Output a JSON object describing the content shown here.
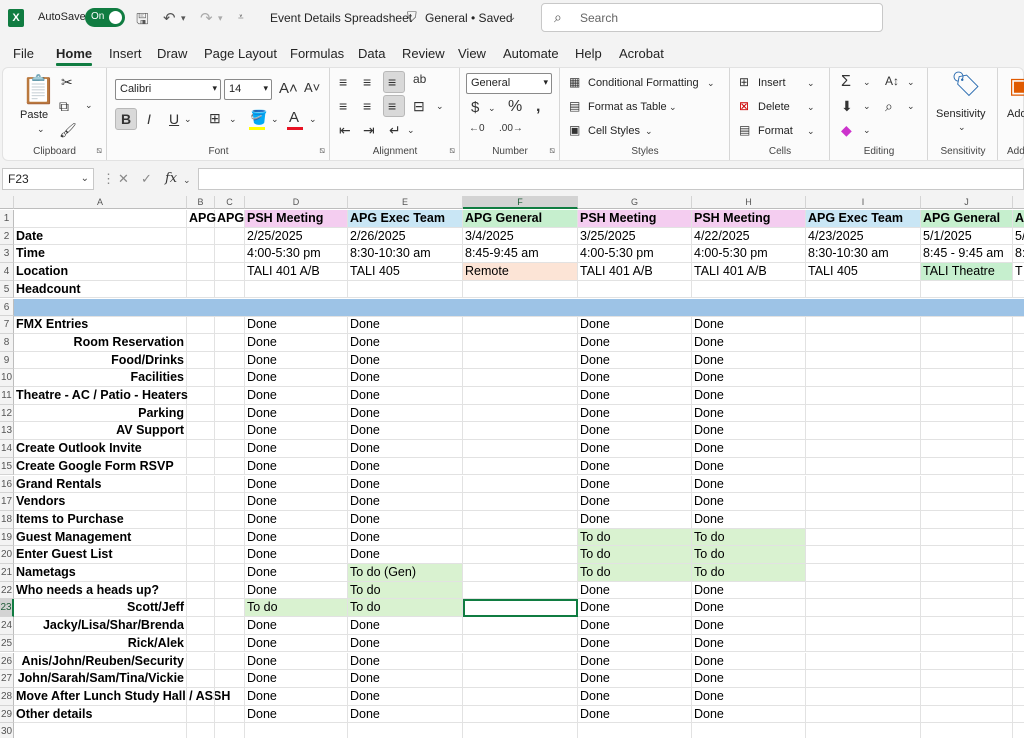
{
  "titlebar": {
    "app_icon": "X",
    "autosave_label": "AutoSave",
    "autosave_state": "On",
    "doc_title": "Event Details Spreadsheet",
    "doc_status": "General • Saved",
    "search_placeholder": "Search"
  },
  "menu_tabs": [
    "File",
    "Home",
    "Insert",
    "Draw",
    "Page Layout",
    "Formulas",
    "Data",
    "Review",
    "View",
    "Automate",
    "Help",
    "Acrobat"
  ],
  "ribbon": {
    "clipboard": {
      "label": "Clipboard",
      "paste": "Paste"
    },
    "font": {
      "label": "Font",
      "font_name": "Calibri",
      "font_size": "14"
    },
    "alignment": {
      "label": "Alignment"
    },
    "number": {
      "label": "Number",
      "format": "General"
    },
    "styles": {
      "label": "Styles",
      "conditional": "Conditional Formatting",
      "table": "Format as Table",
      "cell_styles": "Cell Styles"
    },
    "cells": {
      "label": "Cells",
      "insert": "Insert",
      "delete": "Delete",
      "format": "Format"
    },
    "editing": {
      "label": "Editing"
    },
    "sensitivity": {
      "label": "Sensitivity",
      "button": "Sensitivity"
    },
    "addins": {
      "label": "Add",
      "button": "Add"
    }
  },
  "formula_bar": {
    "name_box": "F23",
    "fx": "fx",
    "formula": ""
  },
  "columns": [
    "A",
    "B",
    "C",
    "D",
    "E",
    "F",
    "G",
    "H",
    "I",
    "J"
  ],
  "selected_column": "F",
  "selected_row": 23,
  "colors": {
    "psh": "#f4cdf0",
    "exec": "#c9e6f5",
    "general": "#c6efce",
    "remote": "#fce4d6",
    "todo": "#d9f2d0",
    "band": "#9dc3e6",
    "accent": "#107c41"
  },
  "rows": [
    {
      "n": 1,
      "a": "",
      "b": "APG",
      "c": "APG",
      "d": "PSH Meeting",
      "e": "APG Exec Team",
      "f": "APG General",
      "g": "PSH Meeting",
      "h": "PSH Meeting",
      "i": "APG Exec Team",
      "j": "APG General",
      "k": "A"
    },
    {
      "n": 2,
      "a": "Date",
      "b": "",
      "c": "",
      "d": "2/25/2025",
      "e": "2/26/2025",
      "f": "3/4/2025",
      "g": "3/25/2025",
      "h": "4/22/2025",
      "i": "4/23/2025",
      "j": "5/1/2025",
      "k": "5/"
    },
    {
      "n": 3,
      "a": "Time",
      "b": "",
      "c": "",
      "d": "4:00-5:30 pm",
      "e": "8:30-10:30 am",
      "f": "8:45-9:45 am",
      "g": "4:00-5:30 pm",
      "h": "4:00-5:30 pm",
      "i": "8:30-10:30 am",
      "j": "8:45 - 9:45 am",
      "k": "8:"
    },
    {
      "n": 4,
      "a": "Location",
      "b": "",
      "c": "",
      "d": "TALI 401 A/B",
      "e": "TALI 405",
      "f": "Remote",
      "g": "TALI 401 A/B",
      "h": "TALI 401 A/B",
      "i": "TALI 405",
      "j": "TALI Theatre",
      "k": "T"
    },
    {
      "n": 5,
      "a": "Headcount",
      "b": "",
      "c": "",
      "d": "",
      "e": "",
      "f": "",
      "g": "",
      "h": "",
      "i": "",
      "j": "",
      "k": ""
    },
    {
      "n": 6,
      "a": "",
      "b": "",
      "c": "",
      "d": "",
      "e": "",
      "f": "",
      "g": "",
      "h": "",
      "i": "",
      "j": "",
      "k": ""
    },
    {
      "n": 7,
      "a": "FMX Entries",
      "d": "Done",
      "e": "Done",
      "f": "",
      "g": "Done",
      "h": "Done"
    },
    {
      "n": 8,
      "a": "Room Reservation",
      "d": "Done",
      "e": "Done",
      "f": "",
      "g": "Done",
      "h": "Done"
    },
    {
      "n": 9,
      "a": "Food/Drinks",
      "d": "Done",
      "e": "Done",
      "f": "",
      "g": "Done",
      "h": "Done"
    },
    {
      "n": 10,
      "a": "Facilities",
      "d": "Done",
      "e": "Done",
      "f": "",
      "g": "Done",
      "h": "Done"
    },
    {
      "n": 11,
      "a": "Theatre - AC / Patio - Heaters",
      "d": "Done",
      "e": "Done",
      "f": "",
      "g": "Done",
      "h": "Done"
    },
    {
      "n": 12,
      "a": "Parking",
      "d": "Done",
      "e": "Done",
      "f": "",
      "g": "Done",
      "h": "Done"
    },
    {
      "n": 13,
      "a": "AV Support",
      "d": "Done",
      "e": "Done",
      "f": "",
      "g": "Done",
      "h": "Done"
    },
    {
      "n": 14,
      "a": "Create Outlook Invite",
      "d": "Done",
      "e": "Done",
      "f": "",
      "g": "Done",
      "h": "Done"
    },
    {
      "n": 15,
      "a": "Create Google Form RSVP",
      "d": "Done",
      "e": "Done",
      "f": "",
      "g": "Done",
      "h": "Done"
    },
    {
      "n": 16,
      "a": "Grand Rentals",
      "d": "Done",
      "e": "Done",
      "f": "",
      "g": "Done",
      "h": "Done"
    },
    {
      "n": 17,
      "a": "Vendors",
      "d": "Done",
      "e": "Done",
      "f": "",
      "g": "Done",
      "h": "Done"
    },
    {
      "n": 18,
      "a": "Items to Purchase",
      "d": "Done",
      "e": "Done",
      "f": "",
      "g": "Done",
      "h": "Done"
    },
    {
      "n": 19,
      "a": "Guest Management",
      "d": "Done",
      "e": "Done",
      "f": "",
      "g": "To do",
      "h": "To do"
    },
    {
      "n": 20,
      "a": "Enter Guest List",
      "d": "Done",
      "e": "Done",
      "f": "",
      "g": "To do",
      "h": "To do"
    },
    {
      "n": 21,
      "a": "Nametags",
      "d": "Done",
      "e": "To do (Gen)",
      "f": "",
      "g": "To do",
      "h": "To do"
    },
    {
      "n": 22,
      "a": "Who needs a heads up?",
      "d": "Done",
      "e": "To do",
      "f": "",
      "g": "Done",
      "h": "Done"
    },
    {
      "n": 23,
      "a": "Scott/Jeff",
      "d": "To do",
      "e": "To do",
      "f": "",
      "g": "Done",
      "h": "Done"
    },
    {
      "n": 24,
      "a": "Jacky/Lisa/Shar/Brenda",
      "d": "Done",
      "e": "Done",
      "f": "",
      "g": "Done",
      "h": "Done"
    },
    {
      "n": 25,
      "a": "Rick/Alek",
      "d": "Done",
      "e": "Done",
      "f": "",
      "g": "Done",
      "h": "Done"
    },
    {
      "n": 26,
      "a": "Anis/John/Reuben/Security",
      "d": "Done",
      "e": "Done",
      "f": "",
      "g": "Done",
      "h": "Done"
    },
    {
      "n": 27,
      "a": "John/Sarah/Sam/Tina/Vickie",
      "d": "Done",
      "e": "Done",
      "f": "",
      "g": "Done",
      "h": "Done"
    },
    {
      "n": 28,
      "a": "Move After Lunch Study Hall / ASSH",
      "d": "Done",
      "e": "Done",
      "f": "",
      "g": "Done",
      "h": "Done"
    },
    {
      "n": 29,
      "a": "Other details",
      "d": "Done",
      "e": "Done",
      "f": "",
      "g": "Done",
      "h": "Done"
    },
    {
      "n": 30,
      "a": ""
    }
  ]
}
